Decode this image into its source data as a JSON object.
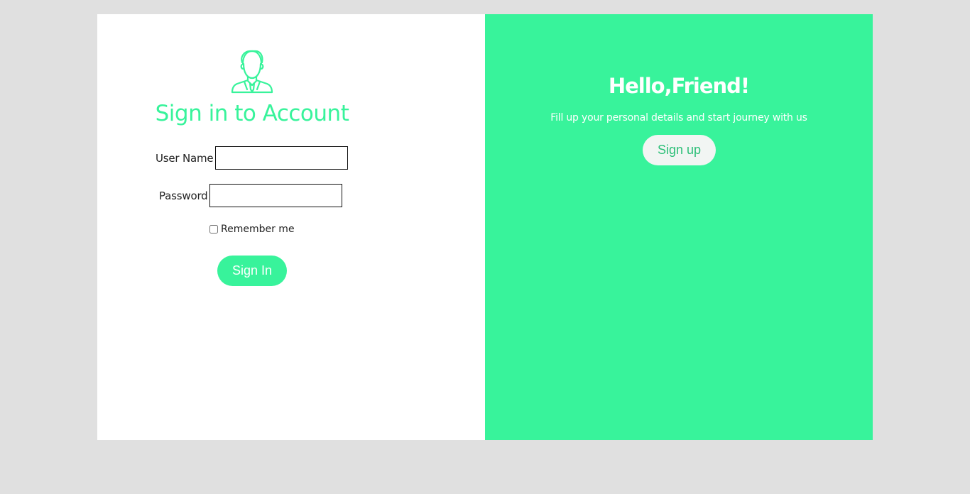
{
  "colors": {
    "accent": "#38f39b",
    "page_background": "#e0e0e0",
    "signup_button_text": "#2dbf78"
  },
  "signin": {
    "avatar_icon": "user-avatar-icon",
    "title": "Sign in to Account",
    "username_label": "User Name",
    "username_value": "",
    "password_label": "Password",
    "password_value": "",
    "remember_label": "Remember me",
    "remember_checked": false,
    "submit_label": "Sign In"
  },
  "signup_panel": {
    "heading": "Hello,Friend!",
    "subtitle": "Fill up your personal details and start journey with us",
    "button_label": "Sign up"
  }
}
